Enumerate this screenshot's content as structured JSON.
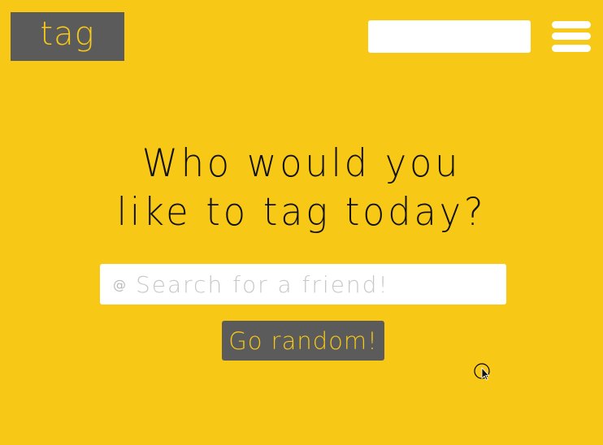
{
  "header": {
    "logo_text": "tag",
    "search_placeholder": "",
    "menu_icon": "hamburger-menu-icon"
  },
  "main": {
    "headline_line1": "Who would you",
    "headline_line2": "like to tag today?",
    "search": {
      "icon": "@",
      "placeholder": "Search for a friend!"
    },
    "random_button_label": "Go random!"
  },
  "colors": {
    "background": "#f7c815",
    "logo_bg": "#5b5b5b",
    "button_bg": "#5b5b5b",
    "accent_text": "#f7c815"
  }
}
